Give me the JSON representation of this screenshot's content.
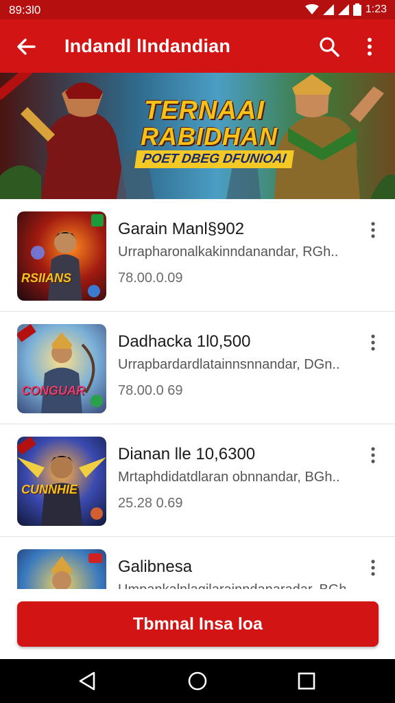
{
  "status_bar": {
    "time": "89:3l0",
    "clock": "1:23"
  },
  "app_bar": {
    "title": "Indandl lIndandian",
    "back_icon": "arrow-left-icon",
    "search_icon": "search-icon",
    "more_icon": "more-vert-icon"
  },
  "banner": {
    "title_line1": "TERNAAI",
    "title_line2": "RABIDHAN",
    "subtitle": "POET DBEG DFUNIOAI"
  },
  "items": [
    {
      "name": "Garain Manl§902",
      "description": "Urrapharonalkakinndanandar, RGh..",
      "price": "78.00.0.09",
      "thumb_label": "RSIIANS"
    },
    {
      "name": "Dadhacka 1l0,500",
      "description": "Urrapbardardlatainnsnnandar, DGn..",
      "price": "78.00.0 69",
      "thumb_label": "CONGUAR"
    },
    {
      "name": "Dianan lle 10,6300",
      "description": "Mrtaphdidatdlaran obnnandar, BGh..",
      "price": "25.28 0.69",
      "thumb_label": "CUNNHIE"
    },
    {
      "name": "Galibnesa",
      "description": "Umpankalnlagilarainndanaradar, BGh..",
      "price": "",
      "thumb_label": ""
    }
  ],
  "cta": {
    "label": "Tbmnal Insa loa"
  },
  "colors": {
    "primary": "#d21414",
    "status_bar": "#b60f10",
    "accent_gold": "#f3c21b"
  },
  "nav": {
    "back_icon": "nav-back-icon",
    "home_icon": "nav-home-icon",
    "recents_icon": "nav-recents-icon"
  }
}
